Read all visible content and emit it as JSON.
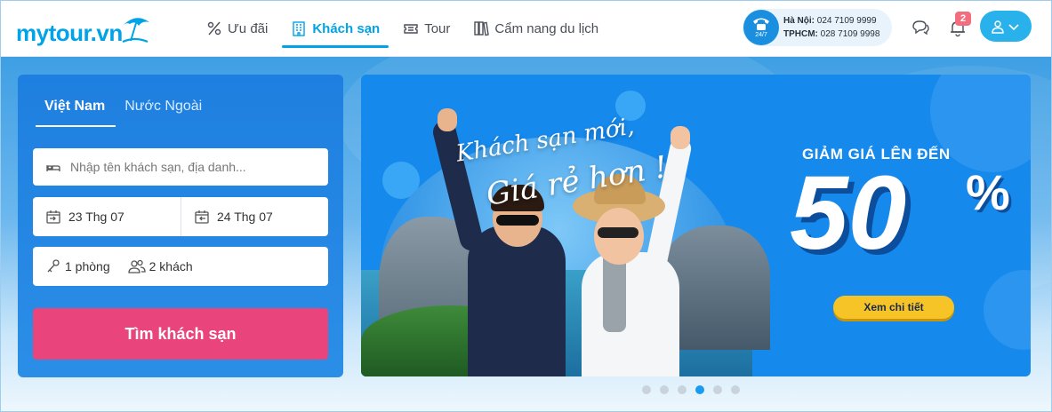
{
  "brand": {
    "logo_text": "mytour.vn"
  },
  "nav": {
    "items": [
      {
        "label": "Ưu đãi",
        "icon": "percent-icon"
      },
      {
        "label": "Khách sạn",
        "icon": "hotel-icon",
        "active": true
      },
      {
        "label": "Tour",
        "icon": "ticket-icon"
      },
      {
        "label": "Cẩm nang du lịch",
        "icon": "book-icon"
      }
    ]
  },
  "hotline": {
    "badge": "24/7",
    "hanoi_label": "Hà Nội:",
    "hanoi_number": "024 7109 9999",
    "hcm_label": "TPHCM:",
    "hcm_number": "028 7109 9998"
  },
  "notifications": {
    "count": "2"
  },
  "search": {
    "tabs": [
      {
        "label": "Việt Nam",
        "active": true
      },
      {
        "label": "Nước Ngoài",
        "active": false
      }
    ],
    "destination_placeholder": "Nhập tên khách sạn, địa danh...",
    "checkin": "23 Thg 07",
    "checkout": "24 Thg 07",
    "rooms": "1 phòng",
    "guests": "2 khách",
    "submit_label": "Tìm khách sạn"
  },
  "banner": {
    "script_line1": "Khách sạn mới,",
    "script_line2": "Giá rẻ hơn !",
    "promo_label": "GIẢM GIÁ LÊN ĐẾN",
    "promo_value": "50",
    "promo_unit": "%",
    "cta_label": "Xem chi tiết"
  },
  "carousel": {
    "count": 6,
    "active_index": 3
  },
  "colors": {
    "brand": "#00a3e8",
    "search_button": "#e9447b",
    "cta": "#f6c427",
    "active_dot": "#1b9bef"
  }
}
